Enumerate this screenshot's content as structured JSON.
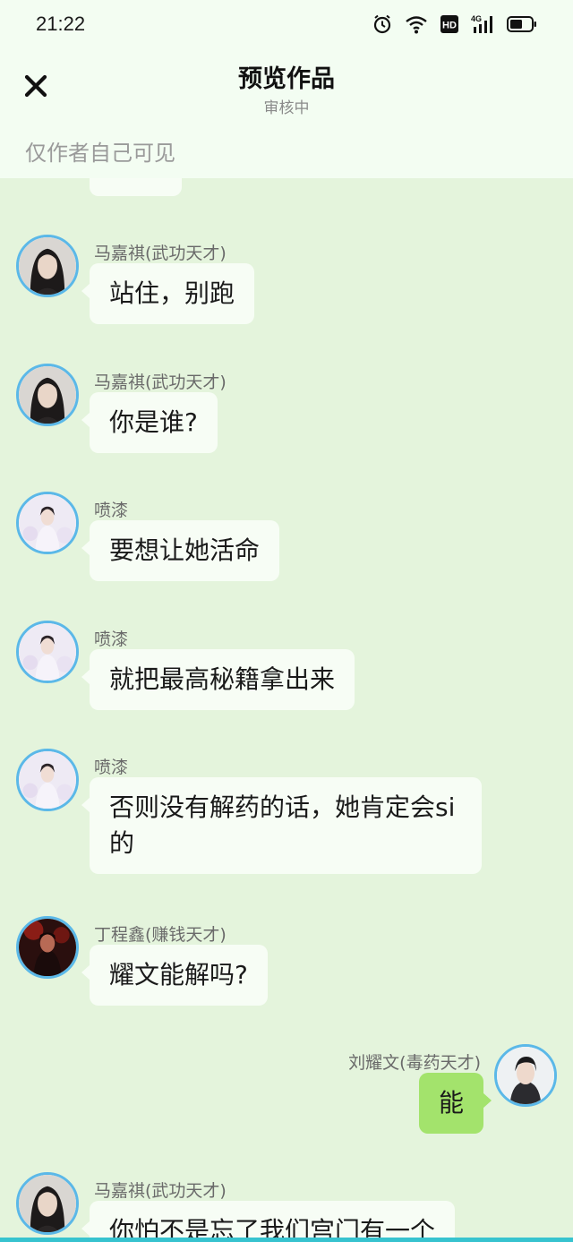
{
  "status_bar": {
    "time": "21:22",
    "icons": [
      "alarm-icon",
      "wifi-icon",
      "hd-icon",
      "signal-4g-icon",
      "battery-icon"
    ],
    "hd_label": "HD",
    "network_label": "4G"
  },
  "header": {
    "title": "预览作品",
    "subtitle": "审核中",
    "visibility_note": "仅作者自己可见",
    "close_icon": "close-icon"
  },
  "colors": {
    "background": "#e4f4dc",
    "header_bg": "#f3fdf2",
    "bubble_incoming": "#f7fdf5",
    "bubble_outgoing": "#a3e36c",
    "avatar_border": "#5bb8e8"
  },
  "messages": [
    {
      "sender": "马嘉祺(武功天才)",
      "text": "站住，别跑",
      "side": "left",
      "avatar": "avatar-majiaqi"
    },
    {
      "sender": "马嘉祺(武功天才)",
      "text": "你是谁?",
      "side": "left",
      "avatar": "avatar-majiaqi"
    },
    {
      "sender": "喷漆",
      "text": "要想让她活命",
      "side": "left",
      "avatar": "avatar-penqi"
    },
    {
      "sender": "喷漆",
      "text": "就把最高秘籍拿出来",
      "side": "left",
      "avatar": "avatar-penqi"
    },
    {
      "sender": "喷漆",
      "text": "否则没有解药的话，她肯定会si的",
      "side": "left",
      "avatar": "avatar-penqi"
    },
    {
      "sender": "丁程鑫(赚钱天才)",
      "text": "耀文能解吗?",
      "side": "left",
      "avatar": "avatar-dingchengxin"
    },
    {
      "sender": "刘耀文(毒药天才)",
      "text": "能",
      "side": "right",
      "avatar": "avatar-liuyaowen"
    },
    {
      "sender": "马嘉祺(武功天才)",
      "text": "你怕不是忘了我们宫门有一个",
      "side": "left",
      "avatar": "avatar-majiaqi"
    }
  ]
}
